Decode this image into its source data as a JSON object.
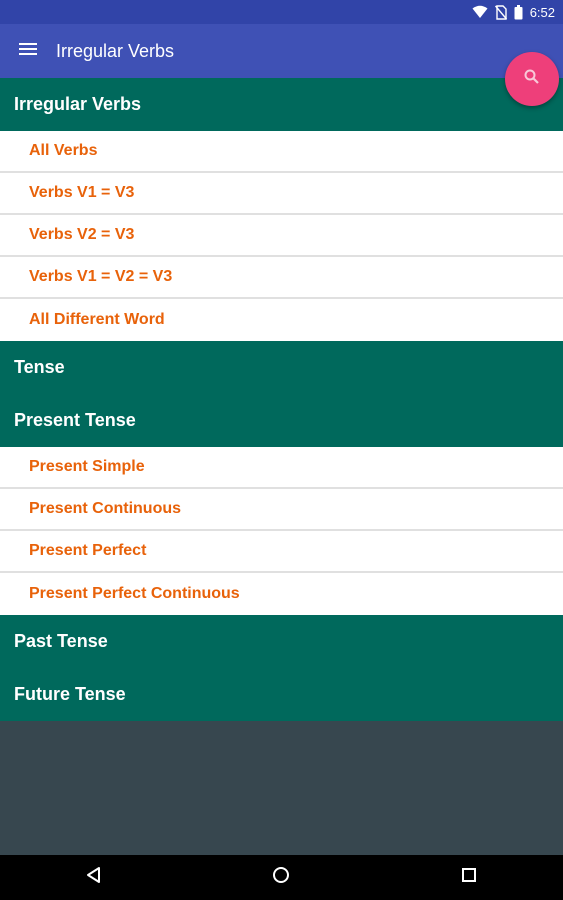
{
  "status_bar": {
    "time": "6:52",
    "icons": [
      "wifi-icon",
      "no-sim-icon",
      "battery-icon"
    ]
  },
  "app_bar": {
    "title": "Irregular Verbs",
    "menu_icon": "hamburger-menu-icon"
  },
  "fab": {
    "icon": "search-icon",
    "color": "#EE3F7A"
  },
  "colors": {
    "status_bar": "#3144A8",
    "app_bar": "#3F51B5",
    "section_header": "#00695C",
    "item_text": "#E8620A",
    "background": "#37474F"
  },
  "sections": {
    "irregular_verbs": {
      "title": "Irregular Verbs",
      "items": [
        "All Verbs",
        "Verbs V1 = V3",
        "Verbs V2 = V3",
        "Verbs V1 = V2 = V3",
        "All Different Word"
      ]
    },
    "tense": {
      "title": "Tense"
    },
    "present_tense": {
      "title": "Present Tense",
      "items": [
        "Present Simple",
        "Present Continuous",
        "Present Perfect",
        "Present Perfect Continuous"
      ]
    },
    "past_tense": {
      "title": "Past Tense"
    },
    "future_tense": {
      "title": "Future Tense"
    }
  },
  "nav_bar": {
    "buttons": [
      "back-icon",
      "home-icon",
      "recents-icon"
    ]
  }
}
